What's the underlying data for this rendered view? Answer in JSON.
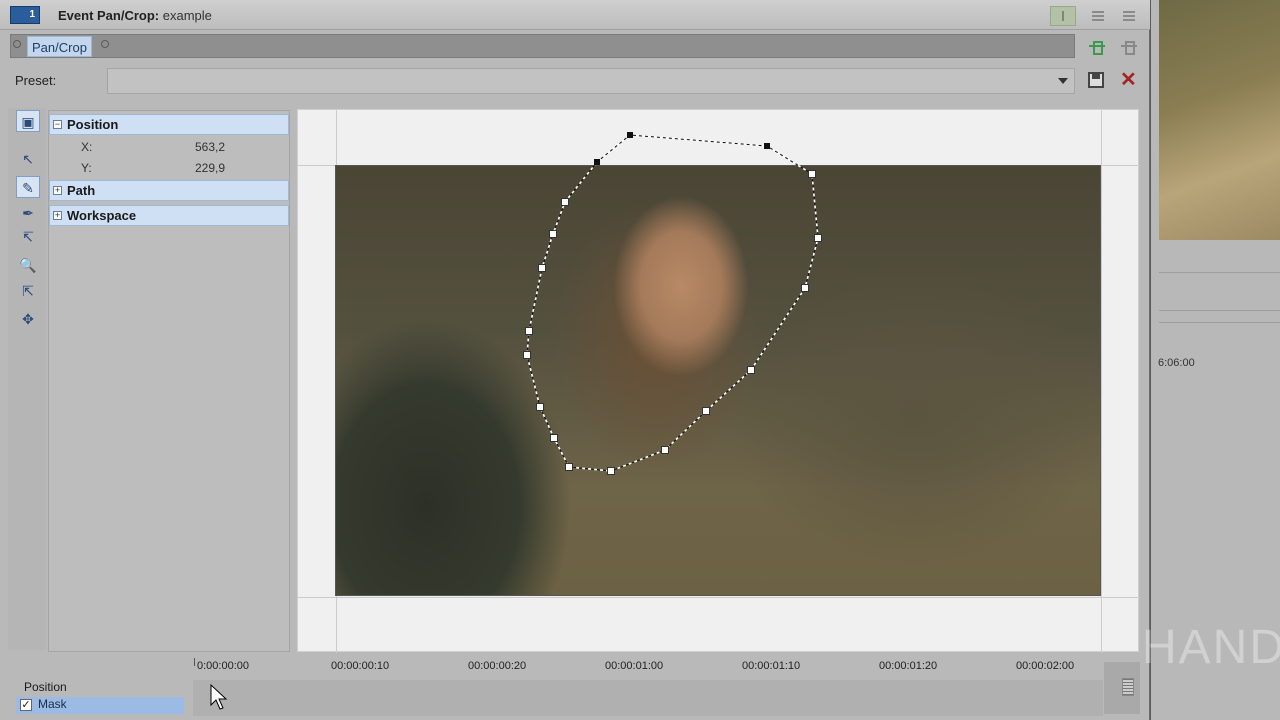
{
  "window": {
    "badge_number": "1",
    "title_bold": "Event Pan/Crop:",
    "title_name": "example"
  },
  "tabs": [
    {
      "label": "Pan/Crop",
      "active": true
    }
  ],
  "preset": {
    "label": "Preset:",
    "value": ""
  },
  "tools": [
    {
      "name": "normal-edit-tool",
      "glyph": "▣",
      "active": true
    },
    {
      "name": "pointer-tool",
      "glyph": "↖",
      "active": false
    },
    {
      "name": "anchor-creation-tool",
      "glyph": "✎",
      "active": true
    },
    {
      "name": "pen-tool",
      "glyph": "✒",
      "active": false
    },
    {
      "name": "split-tool",
      "glyph": "↸",
      "active": false
    },
    {
      "name": "zoom-tool",
      "glyph": "🔍",
      "active": false
    },
    {
      "name": "mask-select-tool",
      "glyph": "⇱",
      "active": false
    },
    {
      "name": "move-tool",
      "glyph": "✥",
      "active": false
    }
  ],
  "properties": {
    "position": {
      "label": "Position",
      "expanded": true,
      "x_label": "X:",
      "x_value": "563,2",
      "y_label": "Y:",
      "y_value": "229,9"
    },
    "path": {
      "label": "Path",
      "expanded": false
    },
    "workspace": {
      "label": "Workspace",
      "expanded": false
    }
  },
  "timeline": {
    "tracks": [
      {
        "label": "Position",
        "selected": false,
        "checked": null
      },
      {
        "label": "Mask",
        "selected": true,
        "checked": true
      }
    ],
    "ruler_labels": [
      "0:00:00:00",
      "00:00:00:10",
      "00:00:00:20",
      "00:00:01:00",
      "00:00:01:10",
      "00:00:01:20",
      "00:00:02:00"
    ]
  },
  "background_window": {
    "time_label": "6:06:00"
  },
  "watermark": "HANDI",
  "colors": {
    "selection_blue": "#cfe0f4",
    "tab_blue": "#c4d6ec",
    "mask_handle": "#ffffff",
    "close_red": "#a02626"
  }
}
